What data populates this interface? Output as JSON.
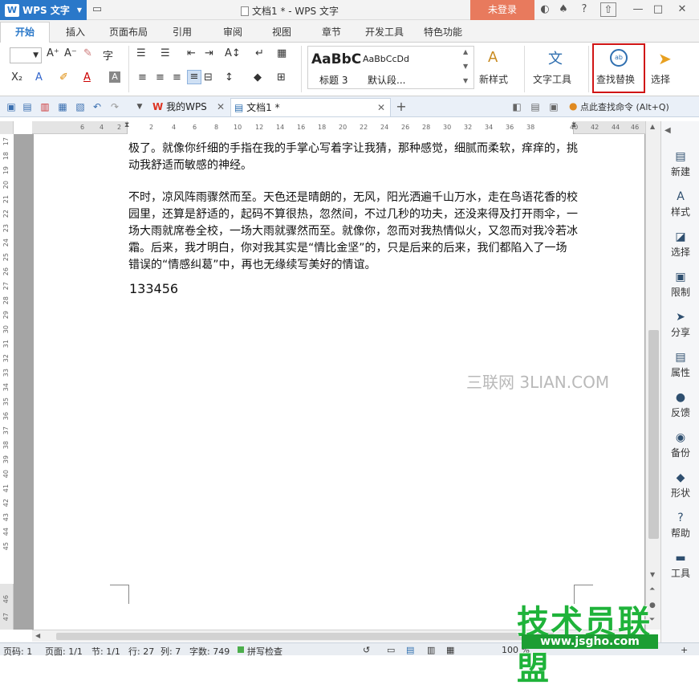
{
  "app": {
    "name": "WPS 文字",
    "logo_letter": "W",
    "doc_title": "文档1 * - WPS 文字",
    "login": "未登录"
  },
  "window_controls": {
    "help": "?",
    "minimize": "—",
    "maximize": "□",
    "close": "✕"
  },
  "menu": {
    "tabs": [
      "开始",
      "插入",
      "页面布局",
      "引用",
      "审阅",
      "视图",
      "章节",
      "开发工具",
      "特色功能"
    ]
  },
  "ribbon": {
    "style_preview_big": "AaBbC",
    "style_preview_small": "AaBbCcDd",
    "style_name_1": "标题 3",
    "style_name_2": "默认段...",
    "new_style": "新样式",
    "text_tools": "文字工具",
    "find_replace": "查找替换",
    "select": "选择"
  },
  "doc_tabs": {
    "wps": "我的WPS",
    "doc1": "文档1 *",
    "add": "+"
  },
  "hint": {
    "text": "点此查找命令 (Alt+Q)"
  },
  "ruler": {
    "h_left": [
      "6",
      "4",
      "2"
    ],
    "h_right": [
      "2",
      "4",
      "6",
      "8",
      "10",
      "12",
      "14",
      "16",
      "18",
      "20",
      "22",
      "24",
      "26",
      "28",
      "30",
      "32",
      "34",
      "36",
      "38",
      "40"
    ],
    "h_end": [
      "42",
      "44",
      "46"
    ],
    "v": [
      "17",
      "18",
      "19",
      "20",
      "21",
      "22",
      "23",
      "24",
      "25",
      "26",
      "27",
      "28",
      "29",
      "30",
      "31",
      "32",
      "33",
      "34",
      "35",
      "36",
      "37",
      "38",
      "39",
      "40",
      "41",
      "42",
      "43",
      "44",
      "45",
      "46",
      "47"
    ]
  },
  "document": {
    "para1": "极了。就像你纤细的手指在我的手掌心写着字让我猜，那种感觉，细腻而柔软，痒痒的，挑动我舒适而敏感的神经。",
    "para2": "不时，凉风阵雨骤然而至。天色还是晴朗的，无风，阳光洒遍千山万水，走在鸟语花香的校园里，还算是舒适的，起码不算很热，忽然间，不过几秒的功夫，还没来得及打开雨伞，一场大雨就席卷全校，一场大雨就骤然而至。就像你，忽而对我热情似火，又忽而对我冷若冰霜。后来，我才明白，你对我其实是“情比金坚”的，只是后来的后来，我们都陷入了一场错误的“情感纠葛”中，再也无缘续写美好的情谊。",
    "number": "133456",
    "watermark": "三联网 3LIAN.COM"
  },
  "sidebar": {
    "items": [
      "新建",
      "样式",
      "选择",
      "限制",
      "分享",
      "属性",
      "反馈",
      "备份",
      "形状",
      "帮助",
      "工具"
    ]
  },
  "status": {
    "page_num": "页码: 1",
    "page": "页面: 1/1",
    "section": "节: 1/1",
    "row": "行: 27",
    "col": "列: 7",
    "words": "字数: 749",
    "spell": "拼写检查",
    "zoom": "100 %"
  },
  "brand": {
    "name": "技术员联盟",
    "url": "www.jsgho.com"
  }
}
